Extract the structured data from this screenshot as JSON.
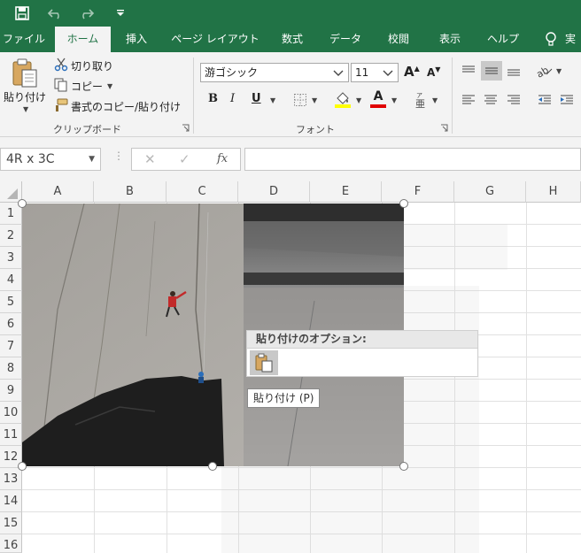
{
  "quick_access": {
    "save_icon": "save-icon",
    "undo_icon": "undo-icon",
    "redo_icon": "redo-icon",
    "customize_icon": "customize-qat-icon"
  },
  "tabs": [
    {
      "label": "ファイル"
    },
    {
      "label": "ホーム"
    },
    {
      "label": "挿入"
    },
    {
      "label": "ページ レイアウト"
    },
    {
      "label": "数式"
    },
    {
      "label": "データ"
    },
    {
      "label": "校閲"
    },
    {
      "label": "表示"
    },
    {
      "label": "ヘルプ"
    },
    {
      "label": "実"
    }
  ],
  "active_tab": "ホーム",
  "clipboard": {
    "paste_label": "貼り付け",
    "cut_label": "切り取り",
    "copy_label": "コピー",
    "format_painter_label": "書式のコピー/貼り付け",
    "group_label": "クリップボード"
  },
  "font": {
    "font_name": "游ゴシック",
    "font_size": "11",
    "group_label": "フォント",
    "bold": "B",
    "italic": "I",
    "underline": "U",
    "grow_icon": "A",
    "shrink_icon": "A",
    "font_color_letter": "A"
  },
  "namebox": "4R x 3C",
  "fx_label": "fx",
  "columns": [
    "A",
    "B",
    "C",
    "D",
    "E",
    "F",
    "G",
    "H"
  ],
  "rows": [
    "1",
    "2",
    "3",
    "4",
    "5",
    "6",
    "7",
    "8",
    "9",
    "10",
    "11",
    "12",
    "13",
    "14",
    "15",
    "16"
  ],
  "paste_options": {
    "header": "貼り付けのオプション:",
    "tooltip": "貼り付け (P)"
  },
  "colors": {
    "excel_green": "#217346",
    "ribbon_bg": "#f3f3f3",
    "highlight_yellow": "#ffff00",
    "font_red": "#e00000"
  }
}
